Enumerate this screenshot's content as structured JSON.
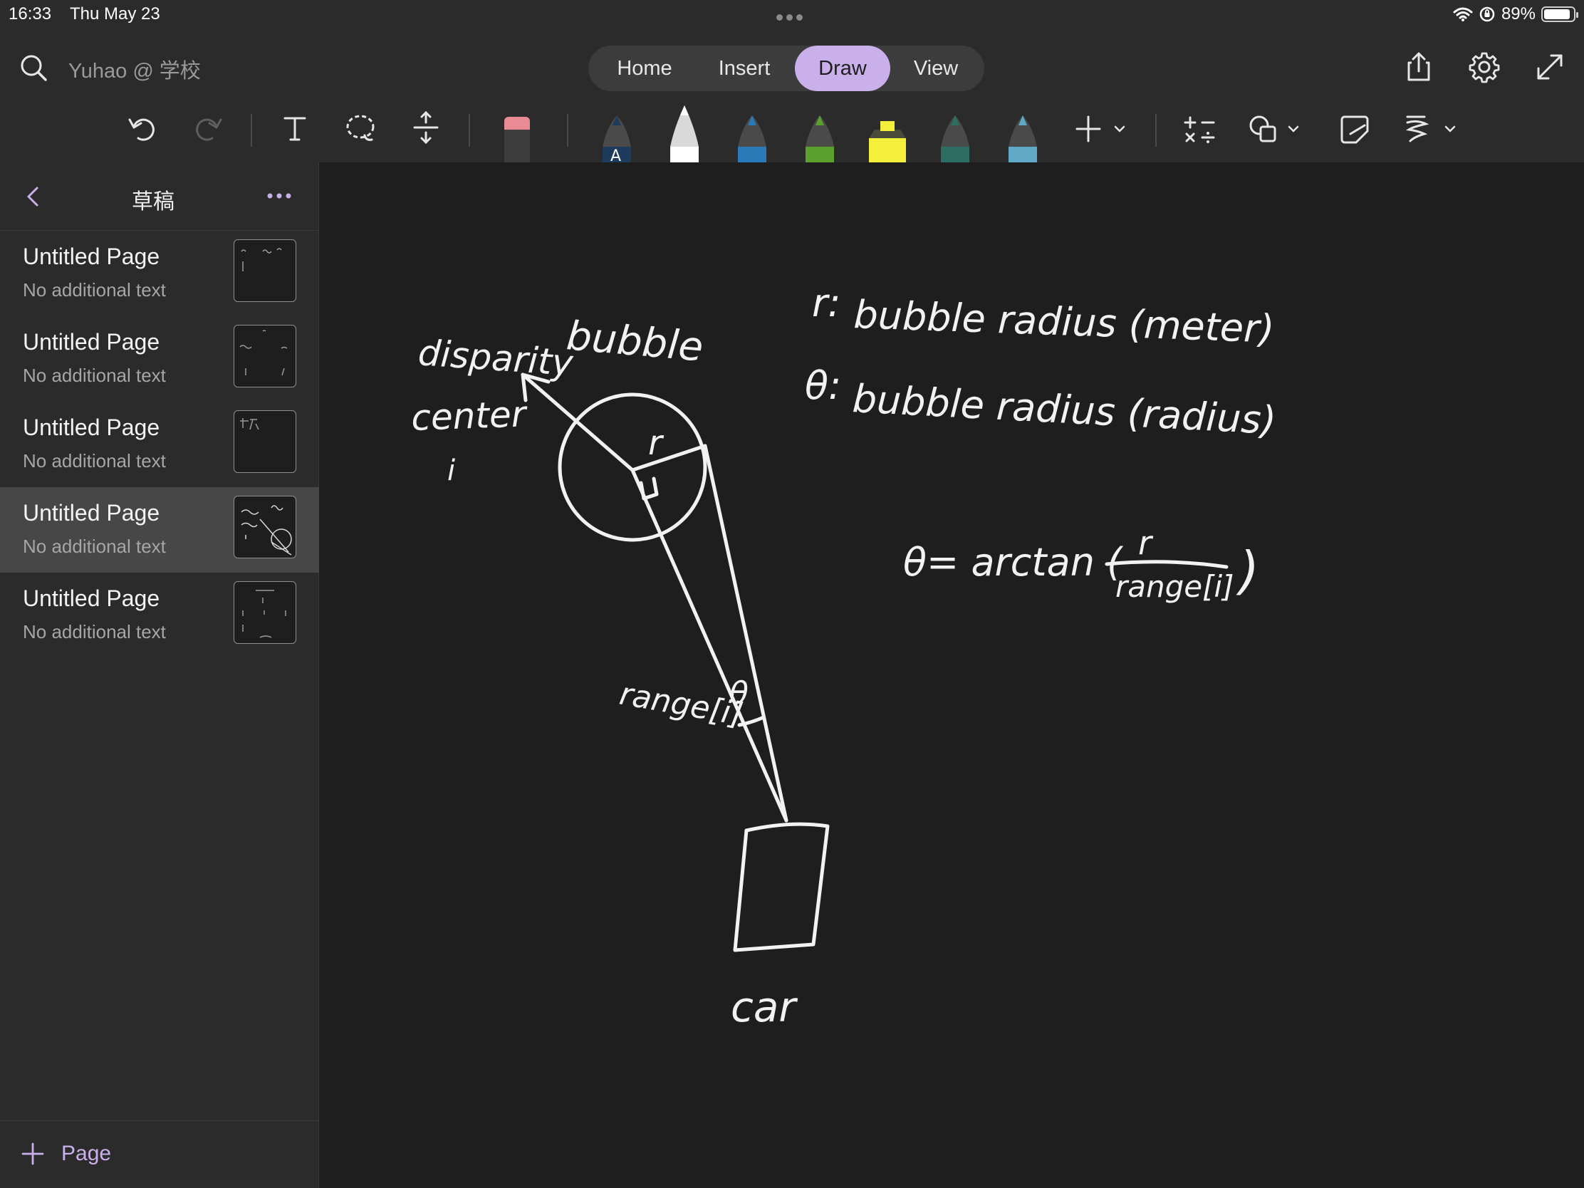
{
  "status": {
    "time": "16:33",
    "date": "Thu May 23",
    "battery": "89%"
  },
  "header": {
    "notebook": "Yuhao @ 学校",
    "tabs": [
      {
        "label": "Home"
      },
      {
        "label": "Insert"
      },
      {
        "label": "Draw"
      },
      {
        "label": "View"
      }
    ],
    "active_tab": "Draw",
    "accent_color": "#c9b0ea"
  },
  "toolbar": {
    "pen_colors": [
      "#1f3b5c",
      "#ffffff",
      "#2a7ab8",
      "#5aa02c",
      "#f4ef3a",
      "#2c6e63",
      "#5fa8c6"
    ],
    "icons": [
      "undo-icon",
      "redo-icon",
      "text-icon",
      "lasso-icon",
      "add-space-icon",
      "eraser-icon",
      "pen-icon",
      "add-pen-icon",
      "math-icon",
      "shapes-icon",
      "ink-to-shape-icon",
      "ink-to-text-icon"
    ]
  },
  "sidebar": {
    "section_title": "草稿",
    "pages": [
      {
        "title": "Untitled Page",
        "subtitle": "No additional text"
      },
      {
        "title": "Untitled Page",
        "subtitle": "No additional text"
      },
      {
        "title": "Untitled Page",
        "subtitle": "No additional text"
      },
      {
        "title": "Untitled Page",
        "subtitle": "No additional text"
      },
      {
        "title": "Untitled Page",
        "subtitle": "No additional text"
      }
    ],
    "selected_index": 3,
    "add_page_label": "Page"
  },
  "canvas": {
    "ink_text": {
      "disparity": "disparity",
      "bubble": "bubble",
      "center": "center",
      "index": "i",
      "radius_symbol": "r",
      "def_r_symbol": "r:",
      "def_r_desc": "bubble radius (meter)",
      "def_theta_symbol": "θ:",
      "def_theta_desc": "bubble radius (radius)",
      "formula_left": "θ= arctan (",
      "formula_numerator": "r",
      "formula_denominator": "range[i]",
      "formula_right": ")",
      "range_label": "range[i]",
      "theta_label": "θ",
      "car_label": "car"
    }
  }
}
